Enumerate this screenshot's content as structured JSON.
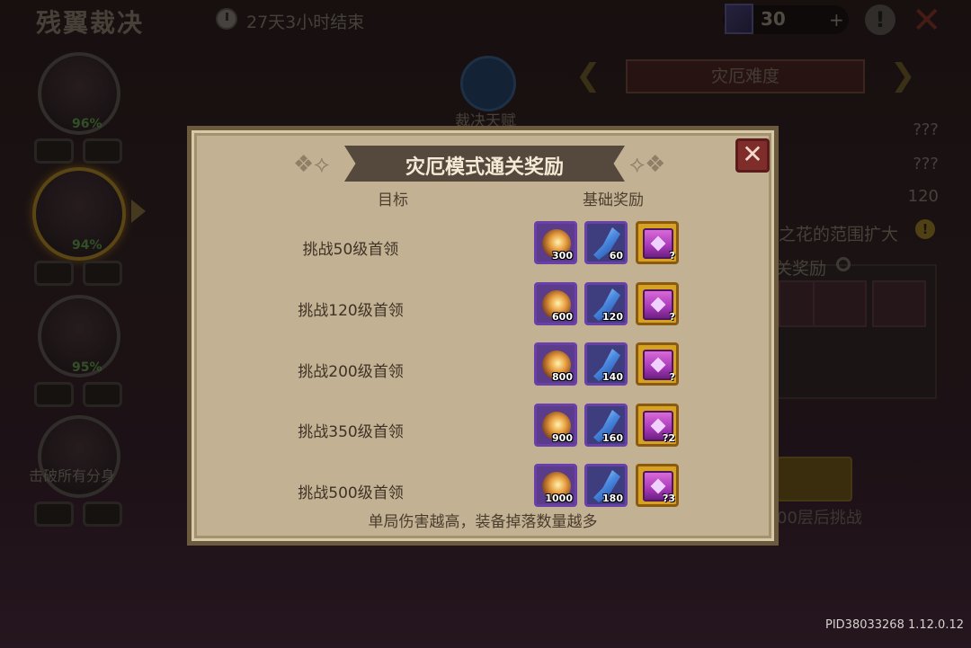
{
  "background": {
    "game_title": "残翼裁决",
    "timer_text": "27天3小时结束",
    "currency_amount": "30",
    "plus_symbol": "+",
    "info_symbol": "!",
    "close_symbol": "✕",
    "hero_percents": [
      "96%",
      "94%",
      "95%"
    ],
    "locked_text": "击破所有分身",
    "talent_label": "裁决天赋",
    "difficulty_banner": "灾厄难度",
    "right_values": [
      "???",
      "???",
      "120"
    ],
    "flower_text": "之花的范围扩大",
    "reward_bar_text": "关奖励",
    "behind_button_text": "00层后挑战"
  },
  "modal": {
    "title": "灾厄模式通关奖励",
    "close_symbol": "✕",
    "col_target": "目标",
    "col_reward": "基础奖励",
    "rows": [
      {
        "label": "挑战50级首领",
        "orb": "300",
        "feather": "60",
        "chest": "?"
      },
      {
        "label": "挑战120级首领",
        "orb": "600",
        "feather": "120",
        "chest": "?"
      },
      {
        "label": "挑战200级首领",
        "orb": "800",
        "feather": "140",
        "chest": "?"
      },
      {
        "label": "挑战350级首领",
        "orb": "900",
        "feather": "160",
        "chest": "?2"
      },
      {
        "label": "挑战500级首领",
        "orb": "1000",
        "feather": "180",
        "chest": "?3"
      }
    ],
    "footer_note": "单局伤害越高，装备掉落数量越多"
  },
  "pid": "PID38033268 1.12.0.12",
  "colors": {
    "modal_bg": "#c3b193",
    "modal_border": "#6b5a3e",
    "title_banner": "#55483c",
    "close_red": "#7e2d2a"
  }
}
